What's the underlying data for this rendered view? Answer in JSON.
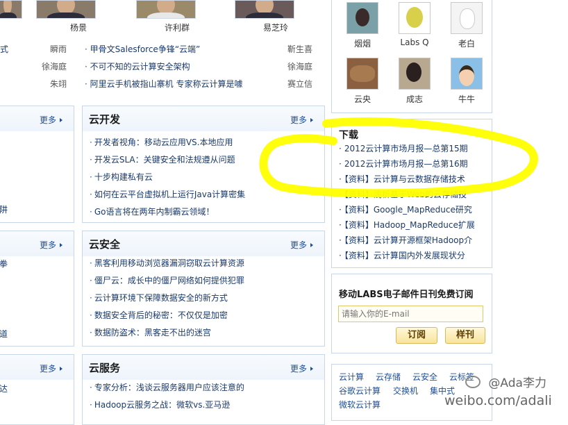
{
  "top_people": [
    {
      "name": ""
    },
    {
      "name": "杨景"
    },
    {
      "name": "许利群"
    },
    {
      "name": "易芝玲"
    }
  ],
  "top_list": {
    "left": [
      {
        "pre": "式",
        "author": "瞬雨"
      },
      {
        "pre": "",
        "author": "徐海庭"
      },
      {
        "pre": "",
        "author": "朱翊"
      }
    ],
    "right": [
      {
        "title": "甲骨文Salesforce争锋“云端”",
        "author": "靳生喜"
      },
      {
        "title": "不可不知的云计算安全架构",
        "author": "徐海庭"
      },
      {
        "title": "阿里云手机被指山寨机 专家称云计算是噱",
        "author": "赛立信"
      }
    ]
  },
  "left_panels": [
    {
      "more": "更多",
      "items": [
        "",
        "",
        "",
        "",
        "阱"
      ]
    },
    {
      "more": "更多",
      "items": [
        "拳",
        "",
        "",
        "",
        "道"
      ]
    },
    {
      "more": "更多",
      "items": [
        "达"
      ]
    }
  ],
  "mid_panels": [
    {
      "title": "云开发",
      "more": "更多",
      "items": [
        "开发者视角：移动云应用VS.本地应用",
        "开发云SLA：关键安全和法规遵从问题",
        "十步构建私有云",
        "如何在云平台虚拟机上运行Java计算密集",
        "Go语言将在两年内制霸云领域！"
      ]
    },
    {
      "title": "云安全",
      "more": "更多",
      "items": [
        "黑客利用移动浏览器漏洞窃取云计算资源",
        "僵尸云：成长中的僵尸网络如何提供犯罪",
        "云计算环境下保障数据安全的新方式",
        "数据安全背后的秘密：不仅仅是加密",
        "数据防盗术：黑客走不出的迷宫"
      ]
    },
    {
      "title": "云服务",
      "more": "更多",
      "items": [
        "专家分析：浅谈云服务器用户应该注意的",
        "Hadoop云服务之战：微软vs.亚马逊"
      ]
    }
  ],
  "avatars": [
    {
      "name": "烟烟"
    },
    {
      "name": "Labs Q"
    },
    {
      "name": "老白"
    },
    {
      "name": "云央"
    },
    {
      "name": "成志"
    },
    {
      "name": "牛牛"
    }
  ],
  "downloads": {
    "title": "下载",
    "items": [
      "2012云计算市场月报—总第15期",
      "2012云计算市场月报—总第16期",
      "【资料】云计算与云数据存储技术",
      "【资料】浅析基于Web的云存储技",
      "【资料】Google_MapReduce研究",
      "【资料】Hadoop_MapReduce扩展",
      "【资料】云计算开源框架Hadoop介",
      "【资料】云计算国内外发展现状分"
    ]
  },
  "subscribe": {
    "title": "移动LABS电子邮件日刊免费订阅",
    "placeholder": "请输入你的E-mail",
    "subscribe_label": "订阅",
    "sample_label": "样刊"
  },
  "tags": [
    "云计算",
    "云存储",
    "云安全",
    "云标签",
    "谷歌云计算",
    "交换机",
    "集中式",
    "微软云计算"
  ],
  "watermark": {
    "handle": "@Ada李力",
    "url": "weibo.com/adali"
  },
  "colors": {
    "link": "#1a3a6a",
    "more": "#1e4f94",
    "panel_border": "#c9d6e8",
    "highlight": "#ffff00"
  }
}
